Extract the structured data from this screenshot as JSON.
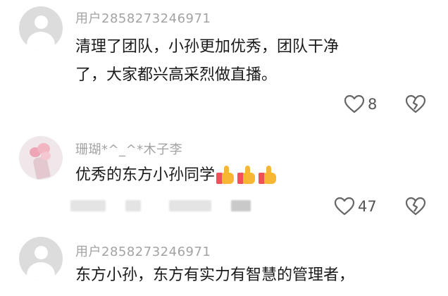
{
  "comments": [
    {
      "username": "用户2858273246971",
      "text_line1": "清理了团队，小孙更加优秀，团队干净",
      "text_line2": "了，大家都兴高采烈做直播。",
      "likes": "8",
      "avatar": "default-avatar"
    },
    {
      "username": "珊瑚*^_^*木子李",
      "text_line1": "优秀的东方小孙同学",
      "likes": "47",
      "avatar": "rose-photo-avatar",
      "emoji": [
        "thumbs-up-emoji",
        "thumbs-up-emoji",
        "thumbs-up-emoji"
      ]
    },
    {
      "username": "用户2858273246971",
      "text_line1": "东方小孙，东方有实力有智慧的管理者，",
      "avatar": "default-avatar"
    }
  ]
}
